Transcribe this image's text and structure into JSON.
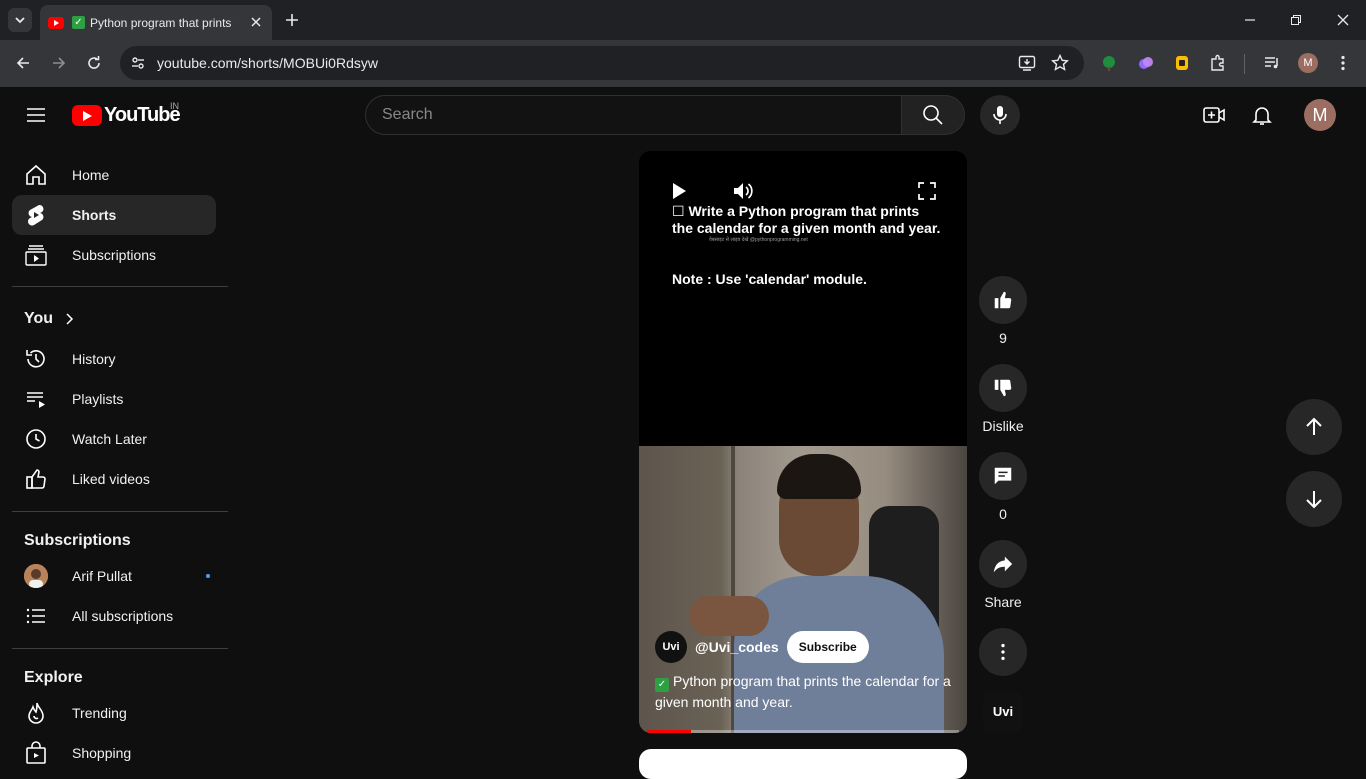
{
  "browser": {
    "tab_title": "Python program that prints the calendar for a given month and year.",
    "url": "youtube.com/shorts/MOBUi0Rdsyw",
    "profile_initial": "M"
  },
  "header": {
    "logo_text": "YouTube",
    "region": "IN",
    "search_placeholder": "Search",
    "avatar_initial": "M"
  },
  "sidebar": {
    "main": [
      {
        "label": "Home",
        "icon": "home-icon"
      },
      {
        "label": "Shorts",
        "icon": "shorts-icon",
        "active": true
      },
      {
        "label": "Subscriptions",
        "icon": "subscriptions-icon"
      }
    ],
    "you_title": "You",
    "you_items": [
      {
        "label": "History",
        "icon": "history-icon"
      },
      {
        "label": "Playlists",
        "icon": "playlists-icon"
      },
      {
        "label": "Watch Later",
        "icon": "watch-later-icon"
      },
      {
        "label": "Liked videos",
        "icon": "liked-videos-icon"
      }
    ],
    "subs_title": "Subscriptions",
    "subs_items": [
      {
        "label": "Arif Pullat",
        "icon": "channel-avatar",
        "new_content": true
      },
      {
        "label": "All subscriptions",
        "icon": "list-icon"
      }
    ],
    "explore_title": "Explore",
    "explore_items": [
      {
        "label": "Trending",
        "icon": "trending-icon"
      },
      {
        "label": "Shopping",
        "icon": "shopping-icon"
      }
    ]
  },
  "short": {
    "question": "☐ Write a Python program that prints the calendar for a given month and year.",
    "tiny_caption": "वेबसाइट से लाइव देखें @pythonprogramming.net",
    "note": "Note : Use 'calendar' module.",
    "channel_avatar_text": "Uvi",
    "channel_handle": "@Uvi_codes",
    "subscribe_label": "Subscribe",
    "title": "Python program that prints the calendar for a given month and year.",
    "progress": 0.14
  },
  "actions": {
    "like_count": "9",
    "dislike_label": "Dislike",
    "comment_count": "0",
    "share_label": "Share",
    "channel_thumb_text": "Uvi"
  },
  "colors": {
    "accent": "#ff0000",
    "background": "#0f0f0f",
    "button_bg": "#272727",
    "unread_dot": "#3ea6ff"
  }
}
